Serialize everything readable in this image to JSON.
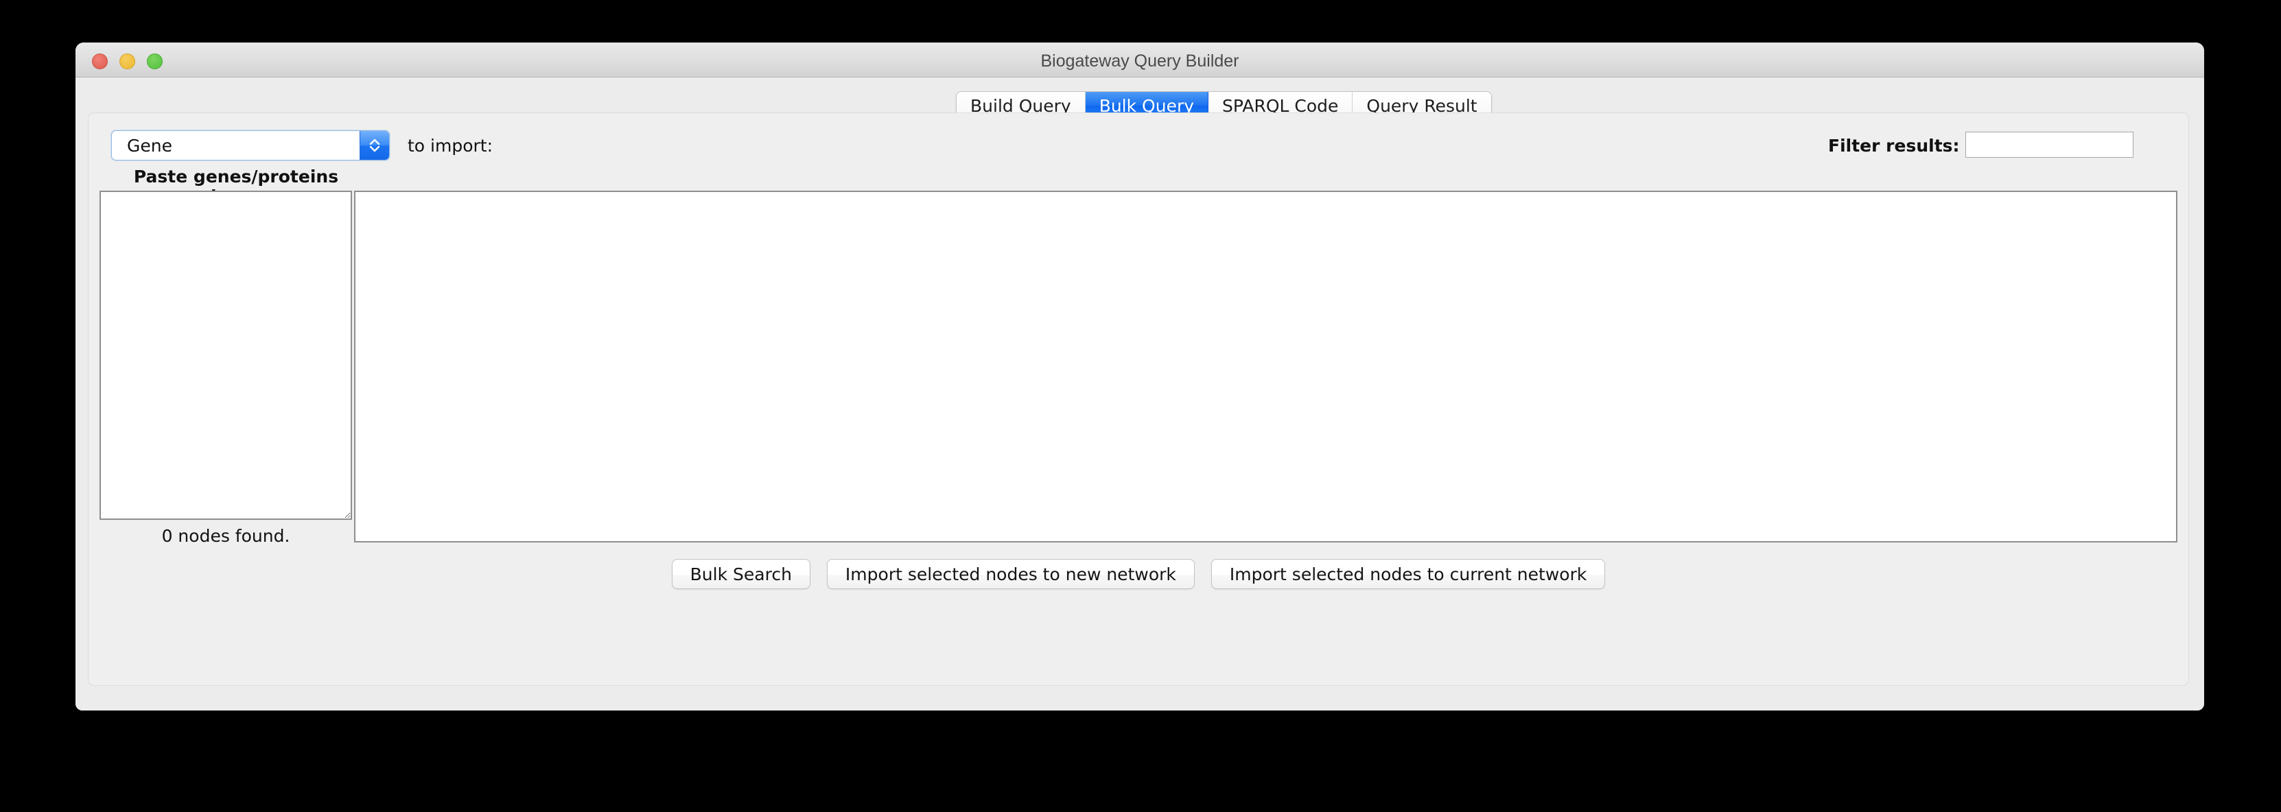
{
  "window": {
    "title": "Biogateway Query Builder",
    "traffic_lights": [
      {
        "name": "close-button",
        "color": "#e05a4e"
      },
      {
        "name": "minimize-button",
        "color": "#edb930"
      },
      {
        "name": "maximize-button",
        "color": "#52c13f"
      }
    ]
  },
  "tabs": [
    {
      "label": "Build Query",
      "selected": false
    },
    {
      "label": "Bulk Query",
      "selected": true
    },
    {
      "label": "SPARQL Code",
      "selected": false
    },
    {
      "label": "Query Result",
      "selected": false
    }
  ],
  "toolbar": {
    "type_select": {
      "value": "Gene",
      "stepper_icon": "chevron-up-down-icon"
    },
    "to_import_label": "to import:",
    "filter": {
      "label": "Filter results:",
      "value": "",
      "placeholder": ""
    }
  },
  "left_panel": {
    "paste_label": "Paste genes/proteins here:",
    "paste_value": "",
    "paste_placeholder": "",
    "status": "0 nodes found."
  },
  "results_panel": {
    "content": "",
    "placeholder": ""
  },
  "buttons": [
    {
      "label": "Bulk Search",
      "name": "bulk-search-button"
    },
    {
      "label": "Import selected nodes to new network",
      "name": "import-to-new-network-button"
    },
    {
      "label": "Import selected nodes to current network",
      "name": "import-to-current-network-button"
    }
  ],
  "colors": {
    "accent": "#1b72f0",
    "window_bg": "#ececec",
    "panel_bg": "#efefef",
    "field_border": "#8e8e8e"
  }
}
